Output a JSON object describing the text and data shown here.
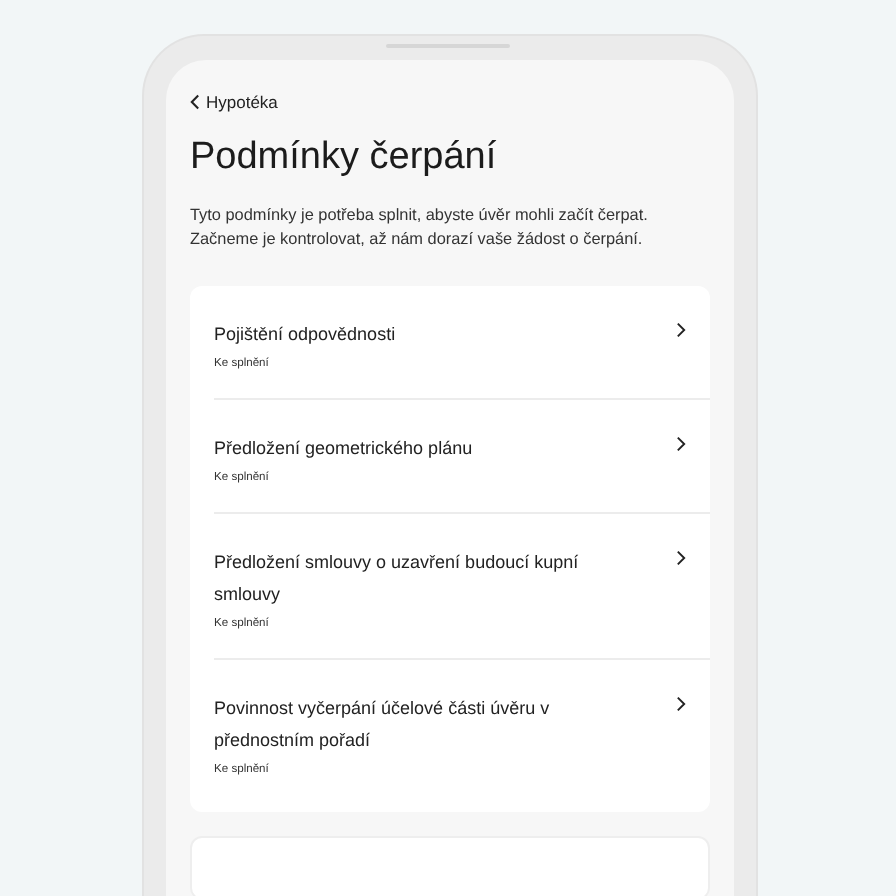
{
  "back_link": {
    "label": "Hypotéka"
  },
  "title": "Podmínky čerpání",
  "description": "Tyto podmínky je potřeba splnit, abyste úvěr mohli začít čerpat. Začneme je kontrolovat, až nám dorazí vaše žádost o čerpání.",
  "conditions": [
    {
      "title": "Pojištění odpovědnosti",
      "status": "Ke splnění"
    },
    {
      "title": "Předložení geometrického plánu",
      "status": "Ke splnění"
    },
    {
      "title": "Předložení smlouvy o uzavření budoucí kupní smlouvy",
      "status": "Ke splnění"
    },
    {
      "title": "Povinnost vyčerpání účelové části úvěru v přednostním pořadí",
      "status": "Ke splnění"
    }
  ]
}
